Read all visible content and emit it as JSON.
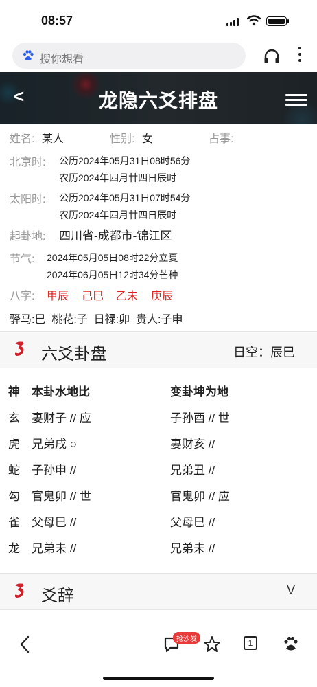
{
  "status": {
    "time": "08:57"
  },
  "browser": {
    "search_placeholder": "搜你想看"
  },
  "header": {
    "back": "<",
    "title": "龙隐六爻排盘"
  },
  "info": {
    "name_label": "姓名:",
    "name_value": "某人",
    "gender_label": "性别:",
    "gender_value": "女",
    "matter_label": "占事:",
    "beijing_label": "北京时:",
    "beijing_solar": "公历2024年05月31日08时56分",
    "beijing_lunar": "农历2024年四月廿四日辰时",
    "sun_label": "太阳时:",
    "sun_solar": "公历2024年05月31日07时54分",
    "sun_lunar": "农历2024年四月廿四日辰时",
    "place_label": "起卦地:",
    "place_value": "四川省-成都市-锦江区",
    "term_label": "节气:",
    "term_1": "2024年05月05日08时22分立夏",
    "term_2": "2024年06月05日12时34分芒种",
    "bazi_label": "八字:",
    "bazi": [
      "甲辰",
      "己巳",
      "乙未",
      "庚辰"
    ],
    "shensha": "驿马:巳  桃花:子  日禄:卯  贵人:子申"
  },
  "hexagram": {
    "section_title": "六爻卦盘",
    "rikong": "日空：辰巳",
    "col_shen": "神",
    "col_main": "本卦水地比",
    "col_change": "变卦坤为地",
    "rows": [
      {
        "shen": "玄",
        "main": "妻财子 // 应",
        "change": "子孙酉 // 世"
      },
      {
        "shen": "虎",
        "main": "兄弟戌 ○",
        "change": "妻财亥 //"
      },
      {
        "shen": "蛇",
        "main": "子孙申 //",
        "change": "兄弟丑 //"
      },
      {
        "shen": "勾",
        "main": "官鬼卯 // 世",
        "change": "官鬼卯 // 应"
      },
      {
        "shen": "雀",
        "main": "父母巳 //",
        "change": "父母巳 //"
      },
      {
        "shen": "龙",
        "main": "兄弟未 //",
        "change": "兄弟未 //"
      }
    ]
  },
  "yaoci": {
    "section_title": "爻辞",
    "toggle": "V"
  },
  "bottom_nav": {
    "comment_badge": "抢沙发",
    "tab_count": "1"
  }
}
